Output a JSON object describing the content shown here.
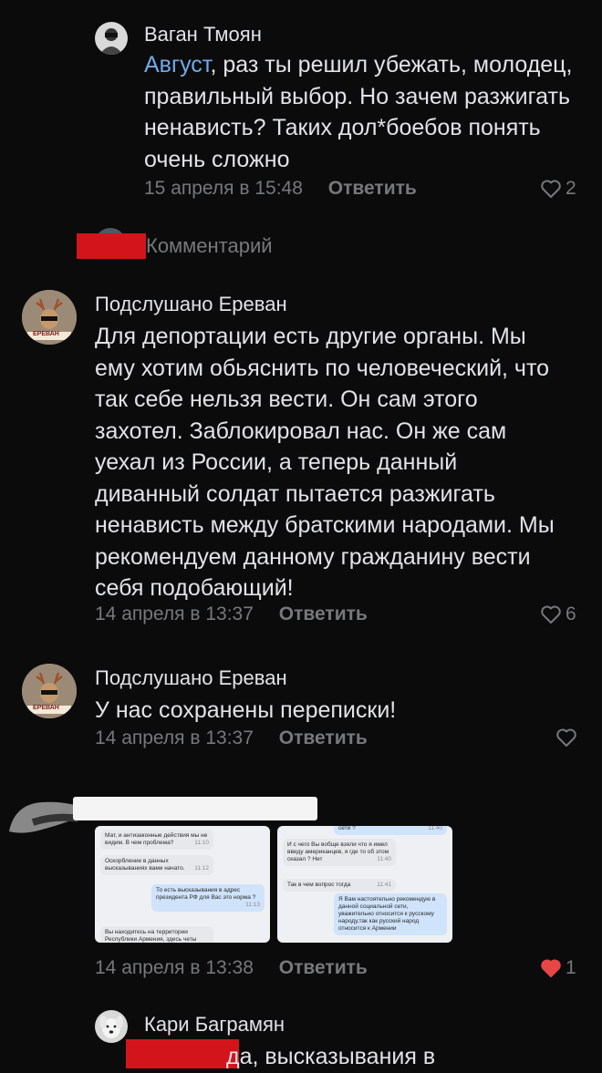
{
  "comments": [
    {
      "author": "Ваган Тмоян",
      "mention": "Август",
      "text": ", раз ты решил убежать, молодец, правильный выбор. Но зачем разжигать ненависть? Таких дол*боебов понять очень сложно",
      "date": "15 апреля в 15:48",
      "reply_label": "Ответить",
      "likes": "2"
    },
    {
      "author": "Подслушано Ереван",
      "avatar_label": "ЕРЕВАН",
      "text": "Для депортации есть другие органы. Мы ему хотим обьяснить по человеческий, что так себе нельзя вести. Он сам этого захотел. Заблокировал нас. Он же сам уехал из России, а теперь данный диванный солдат пытается разжигать ненависть между братскими народами. Мы рекомендуем данному гражданину вести себя подобающий!",
      "date": "14 апреля в 13:37",
      "reply_label": "Ответить",
      "likes": "6"
    },
    {
      "author": "Подслушано Ереван",
      "avatar_label": "ЕРЕВАН",
      "text": "У нас сохранены переписки!",
      "date": "14 апреля в 13:37",
      "reply_label": "Ответить",
      "likes": ""
    },
    {
      "date": "14 апреля в 13:38",
      "reply_label": "Ответить",
      "likes": "1"
    },
    {
      "author": "Кари Баграмян",
      "text": "да, высказывания в"
    }
  ],
  "redacted_row": {
    "label": "Комментарий"
  },
  "screenshot_left": [
    {
      "kind": "in",
      "text": "Мат, и антизаконные действия мы не видим. В чем проблема?",
      "time": "11:10"
    },
    {
      "kind": "in",
      "text": "Оскорбление в данных высказываниях вами начато.",
      "time": "11:12"
    },
    {
      "kind": "out",
      "text": "То есть высказывания в адрес президента РФ для Вас это норма ?",
      "time": "11:13"
    },
    {
      "kind": "in",
      "text": "Вы находитесь на территории Республики Армения, здесь четы",
      "time": ""
    }
  ],
  "screenshot_right": [
    {
      "kind": "out",
      "text": "сети ?",
      "time": "11:40"
    },
    {
      "kind": "in",
      "text": "И с чего Вы вобще взяли что я имел ввиду американцев, я где то об этом сказал ? Нет",
      "time": "11:40"
    },
    {
      "kind": "in",
      "text": "Так в чем вопрос тогда",
      "time": "11:41"
    },
    {
      "kind": "out",
      "text": "Я Вам настоятельно рекомендую в данной социальной сети, уважительно относится к русскому народу,так как русский народ относится к Армении",
      "time": ""
    }
  ],
  "colors": {
    "background": "#0b0b0c",
    "link": "#71aaeb",
    "meta": "#76787a",
    "liked": "#e64646"
  }
}
